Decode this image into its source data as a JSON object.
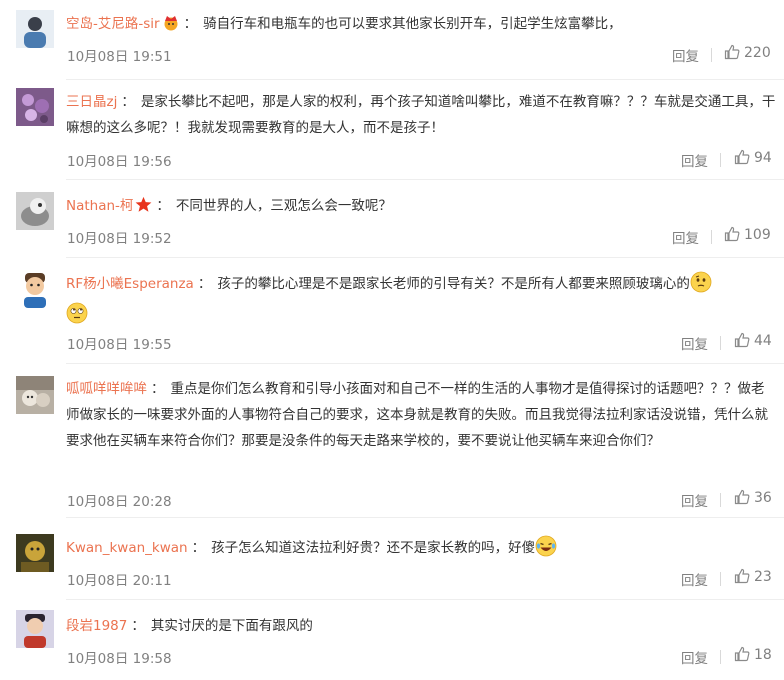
{
  "comments": [
    {
      "username": "空岛-艾尼路-sir",
      "badge": "crown-icon",
      "text": "骑自行车和电瓶车的也可以要求其他家长别开车，引起学生炫富攀比，",
      "time": "10月08日 19:51",
      "reply_label": "回复",
      "likes": "220"
    },
    {
      "username": "三日晶zj",
      "text": "是家长攀比不起吧，那是人家的权利，再个孩子知道啥叫攀比，难道不在教育嘛？？？车就是交通工具，干嘛想的这么多呢？！我就发现需要教育的是大人，而不是孩子！",
      "time": "10月08日 19:56",
      "reply_label": "回复",
      "likes": "94"
    },
    {
      "username": "Nathan-柯",
      "badge": "red-star-icon",
      "text": "不同世界的人，三观怎么会一致呢？",
      "time": "10月08日 19:52",
      "reply_label": "回复",
      "likes": "109"
    },
    {
      "username": "RF杨小曦Esperanza",
      "text": "孩子的攀比心理是不是跟家长老师的引导有关？不是所有人都要来照顾玻璃心的",
      "emojis": [
        "thinking-emoji-icon",
        "rolling-eyes-emoji-icon"
      ],
      "time": "10月08日 19:55",
      "reply_label": "回复",
      "likes": "44"
    },
    {
      "username": "呱呱咩咩哞哞",
      "text": "重点是你们怎么教育和引导小孩面对和自己不一样的生活的人事物才是值得探讨的话题吧？？？做老师做家长的一味要求外面的人事物符合自己的要求，这本身就是教育的失败。而且我觉得法拉利家话没说错，凭什么就要求他在买辆车来符合你们？那要是没条件的每天走路来学校的，要不要说让他买辆车来迎合你们？",
      "time": "10月08日 20:28",
      "reply_label": "回复",
      "likes": "36"
    },
    {
      "username": "Kwan_kwan_kwan",
      "text": "孩子怎么知道这法拉利好贵？还不是家长教的吗，好傻",
      "emojis": [
        "laughing-tears-emoji-icon"
      ],
      "time": "10月08日 20:11",
      "reply_label": "回复",
      "likes": "23"
    },
    {
      "username": "段岩1987",
      "text": "其实讨厌的是下面有跟风的",
      "time": "10月08日 19:58",
      "reply_label": "回复",
      "likes": "18"
    }
  ],
  "colors": {
    "username": "#eb7350",
    "text": "#333333",
    "meta": "#808080"
  },
  "icons": {
    "like": "thumbs-up-icon"
  }
}
